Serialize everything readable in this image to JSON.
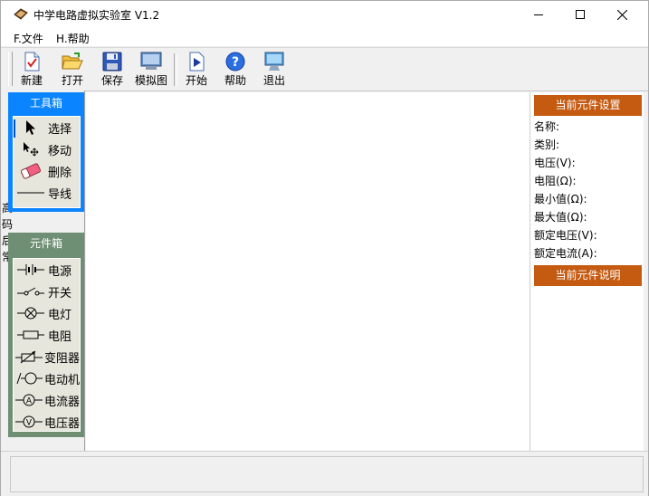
{
  "window": {
    "title": "中学电路虚拟实验室 V1.2",
    "icon": "book-icon",
    "controls": [
      "minimize-icon",
      "maximize-icon",
      "close-icon"
    ]
  },
  "menu": {
    "file": "F.文件",
    "help": "H.帮助"
  },
  "toolbar": {
    "new": "新建",
    "open": "打开",
    "save": "保存",
    "simulate_view": "模拟图",
    "start": "开始",
    "help": "帮助",
    "exit": "退出"
  },
  "toolbox": {
    "title": "工具箱",
    "tools": [
      "选择",
      "移动",
      "删除",
      "导线"
    ]
  },
  "components": {
    "title": "元件箱",
    "items": [
      "电源",
      "开关",
      "电灯",
      "电阻",
      "变阻器",
      "电动机",
      "电流器",
      "电压器"
    ]
  },
  "stray_chars": [
    "高",
    "码",
    "后",
    "常"
  ],
  "properties": {
    "header": "当前元件设置",
    "fields": [
      "名称:",
      "类别:",
      "电压(V):",
      "电阻(Ω):",
      "最小值(Ω):",
      "最大值(Ω):",
      "额定电压(V):",
      "额定电流(A):"
    ],
    "description_header": "当前元件说明"
  },
  "colors": {
    "toolbox_bg": "#0a84ff",
    "components_bg": "#6e8f73",
    "right_header_bg": "#c55a11"
  }
}
